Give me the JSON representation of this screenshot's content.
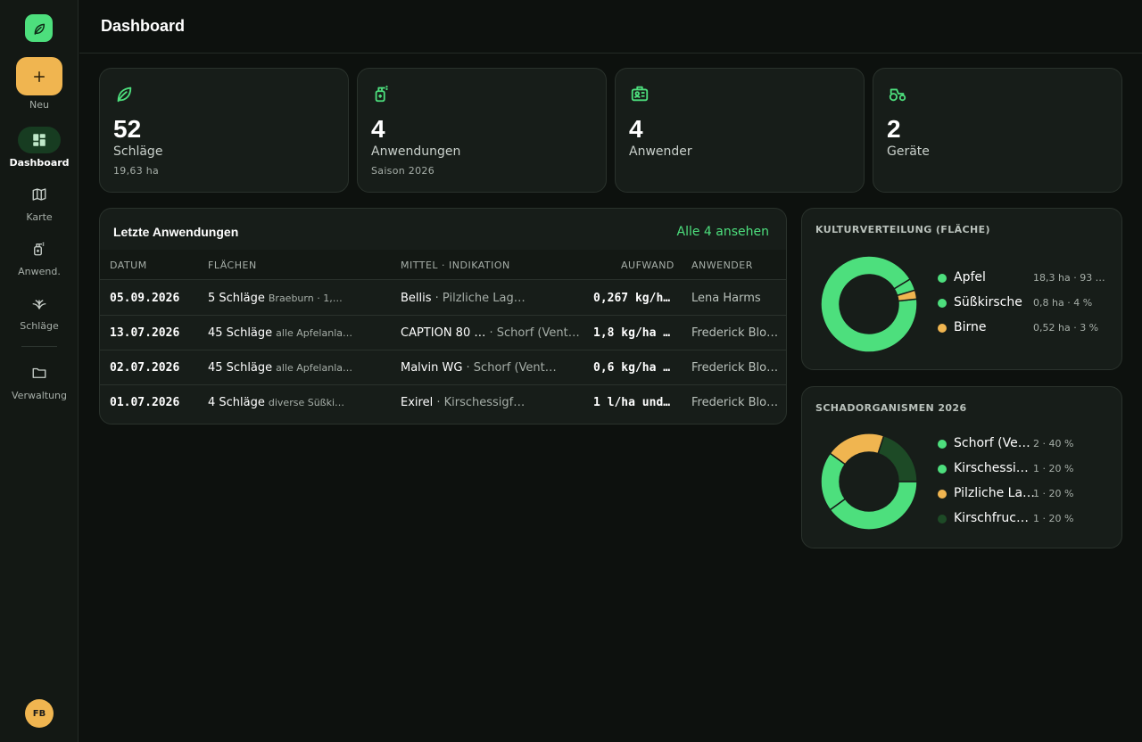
{
  "sidebar": {
    "new_label": "Neu",
    "items": [
      {
        "label": "Dashboard",
        "icon": "dashboard-icon",
        "active": true
      },
      {
        "label": "Karte",
        "icon": "map-icon",
        "active": false
      },
      {
        "label": "Anwend.",
        "icon": "spray-icon",
        "active": false
      },
      {
        "label": "Schläge",
        "icon": "plant-icon",
        "active": false
      },
      {
        "label": "Verwaltung",
        "icon": "folder-icon",
        "active": false
      }
    ],
    "user_initials": "FB"
  },
  "header": {
    "title": "Dashboard"
  },
  "stats": [
    {
      "value": "52",
      "label": "Schläge",
      "sub": "19,63 ha",
      "icon": "leaf-icon"
    },
    {
      "value": "4",
      "label": "Anwendungen",
      "sub": "Saison 2026",
      "icon": "spray-icon"
    },
    {
      "value": "4",
      "label": "Anwender",
      "sub": "",
      "icon": "id-card-icon"
    },
    {
      "value": "2",
      "label": "Geräte",
      "sub": "",
      "icon": "tractor-icon"
    }
  ],
  "recent": {
    "title": "Letzte Anwendungen",
    "link": "Alle 4 ansehen",
    "columns": {
      "datum": "DATUM",
      "flaechen": "FLÄCHEN",
      "mittel": "MITTEL · INDIKATION",
      "aufwand": "AUFWAND",
      "anwender": "ANWENDER"
    },
    "rows": [
      {
        "datum": "05.09.2026",
        "flaechen": "5 Schläge",
        "flaechen_sub": "Braeburn · 1,…",
        "mittel": "Bellis",
        "indikation": " · Pilzliche Lag…",
        "aufwand": "0,267 kg/h…",
        "anwender": "Lena Harms"
      },
      {
        "datum": "13.07.2026",
        "flaechen": "45 Schläge",
        "flaechen_sub": "alle Apfelanla…",
        "mittel": "CAPTION 80 …",
        "indikation": " · Schorf (Vent…",
        "aufwand": "1,8 kg/ha …",
        "anwender": "Frederick Blo…"
      },
      {
        "datum": "02.07.2026",
        "flaechen": "45 Schläge",
        "flaechen_sub": "alle Apfelanla…",
        "mittel": "Malvin WG",
        "indikation": " · Schorf (Vent…",
        "aufwand": "0,6 kg/ha …",
        "anwender": "Frederick Blo…"
      },
      {
        "datum": "01.07.2026",
        "flaechen": "4 Schläge",
        "flaechen_sub": "diverse Süßki…",
        "mittel": "Exirel",
        "indikation": " · Kirschessigf…",
        "aufwand": "1 l/ha und…",
        "anwender": "Frederick Blo…"
      }
    ]
  },
  "colors": {
    "green": "#4ddf7d",
    "amber": "#f0b550",
    "dark_green": "#1d4a26"
  },
  "chart_data": [
    {
      "type": "pie",
      "title": "KULTURVERTEILUNG (FLÄCHE)",
      "slices": [
        {
          "name": "Apfel",
          "value": 93,
          "label": "18,3 ha · 93 …",
          "color": "#4ddf7d"
        },
        {
          "name": "Süßkirsche",
          "value": 4,
          "label": "0,8 ha · 4 %",
          "color": "#4ddf7d"
        },
        {
          "name": "Birne",
          "value": 3,
          "label": "0,52 ha · 3 %",
          "color": "#f0b550"
        }
      ]
    },
    {
      "type": "pie",
      "title": "SCHADORGANISMEN 2026",
      "slices": [
        {
          "name": "Schorf (Ve…",
          "value": 40,
          "label": "2 · 40 %",
          "color": "#4ddf7d"
        },
        {
          "name": "Kirschessi…",
          "value": 20,
          "label": "1 · 20 %",
          "color": "#4ddf7d"
        },
        {
          "name": "Pilzliche La…",
          "value": 20,
          "label": "1 · 20 %",
          "color": "#f0b550"
        },
        {
          "name": "Kirschfruc…",
          "value": 20,
          "label": "1 · 20 %",
          "color": "#1d4a26"
        }
      ]
    }
  ]
}
